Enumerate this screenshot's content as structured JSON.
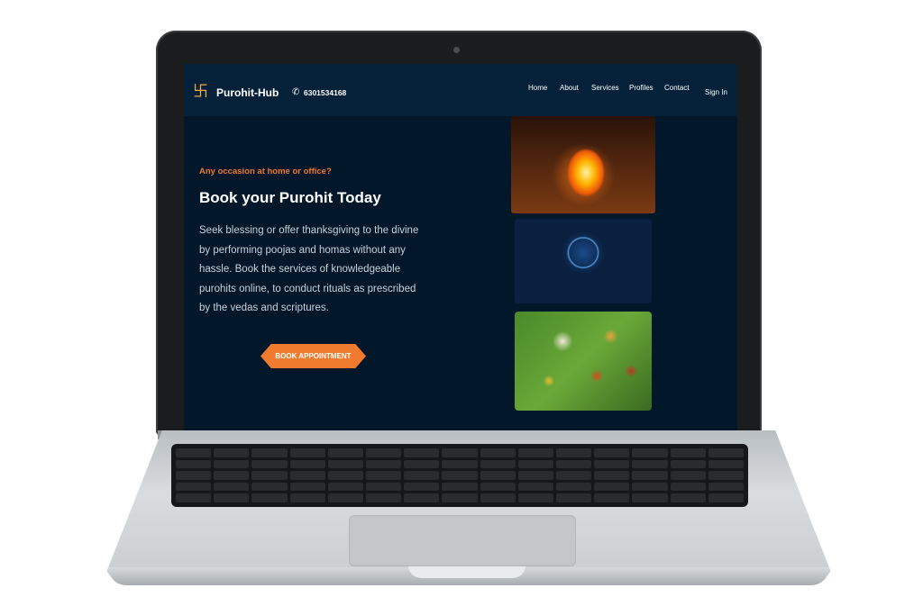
{
  "site": {
    "brand": "Purohit-Hub",
    "phone": "6301534168",
    "nav": [
      "Home",
      "About",
      "Services",
      "Profiles",
      "Contact"
    ],
    "sign_in": "Sign In"
  },
  "hero": {
    "subtitle": "Any occasion at home or office?",
    "title": "Book your Purohit Today",
    "text": "Seek blessing or offer thanksgiving to the divine by performing poojas and homas without any hassle. Book the services of knowledgeable purohits online, to conduct rituals as prescribed by the vedas and scriptures.",
    "cta": "BOOK APPOINTMENT"
  },
  "icons": {
    "logo": "swastika-icon",
    "phone": "phone-icon"
  },
  "colors": {
    "nav_bg": "#05213a",
    "page_bg": "#03172a",
    "accent": "#f07a2e"
  }
}
